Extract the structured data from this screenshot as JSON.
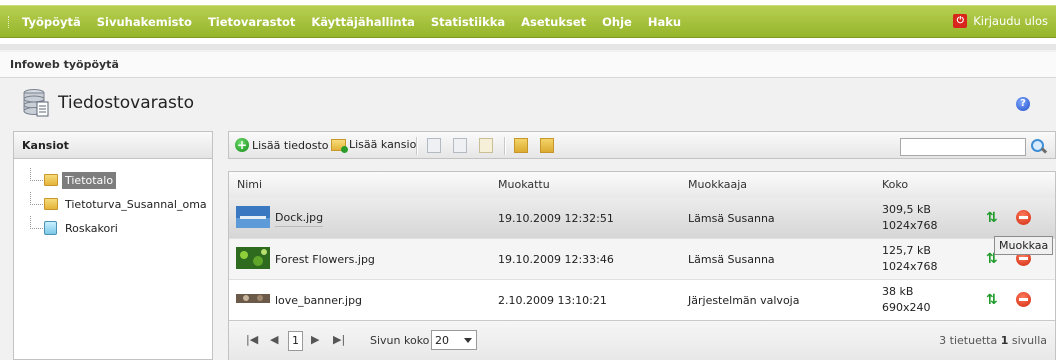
{
  "nav": {
    "items": [
      "Työpöytä",
      "Sivuhakemisto",
      "Tietovarastot",
      "Käyttäjähallinta",
      "Statistiikka",
      "Asetukset",
      "Ohje",
      "Haku"
    ],
    "logout": "Kirjaudu ulos"
  },
  "breadcrumb": "Infoweb työpöytä",
  "page": {
    "title": "Tiedostovarasto"
  },
  "folders": {
    "title": "Kansiot",
    "items": [
      "Tietotalo",
      "Tietoturva_Susannal_oma",
      "Roskakori"
    ],
    "selected": "Tietotalo"
  },
  "toolbar": {
    "add_file": "Lisää tiedosto",
    "add_folder": "Lisää kansio",
    "search_value": ""
  },
  "grid": {
    "columns": [
      "Nimi",
      "Muokattu",
      "Muokkaaja",
      "Koko"
    ],
    "rows": [
      {
        "name": "Dock.jpg",
        "modified": "19.10.2009 12:32:51",
        "editor": "Lämsä Susanna",
        "size": "309,5 kB",
        "dims": "1024x768"
      },
      {
        "name": "Forest Flowers.jpg",
        "modified": "19.10.2009 12:33:46",
        "editor": "Lämsä Susanna",
        "size": "125,7 kB",
        "dims": "1024x768"
      },
      {
        "name": "love_banner.jpg",
        "modified": "2.10.2009 13:10:21",
        "editor": "Järjestelmän valvoja",
        "size": "38 kB",
        "dims": "690x240"
      }
    ],
    "tooltip": "Muokkaa"
  },
  "pager": {
    "first": "K",
    "prev": "◀",
    "current": "1",
    "next": "▶",
    "last": "▶|",
    "page_size_label": "Sivun koko",
    "page_size": "20",
    "info_count": "3",
    "info_text1": "tietuetta",
    "info_pages": "1",
    "info_text2": "sivulla"
  },
  "colors": {
    "nav": "#a6c23b",
    "selected_folder": "#7d7d7d",
    "add_green": "#1f9b2a",
    "delete_red": "#d0280c"
  }
}
